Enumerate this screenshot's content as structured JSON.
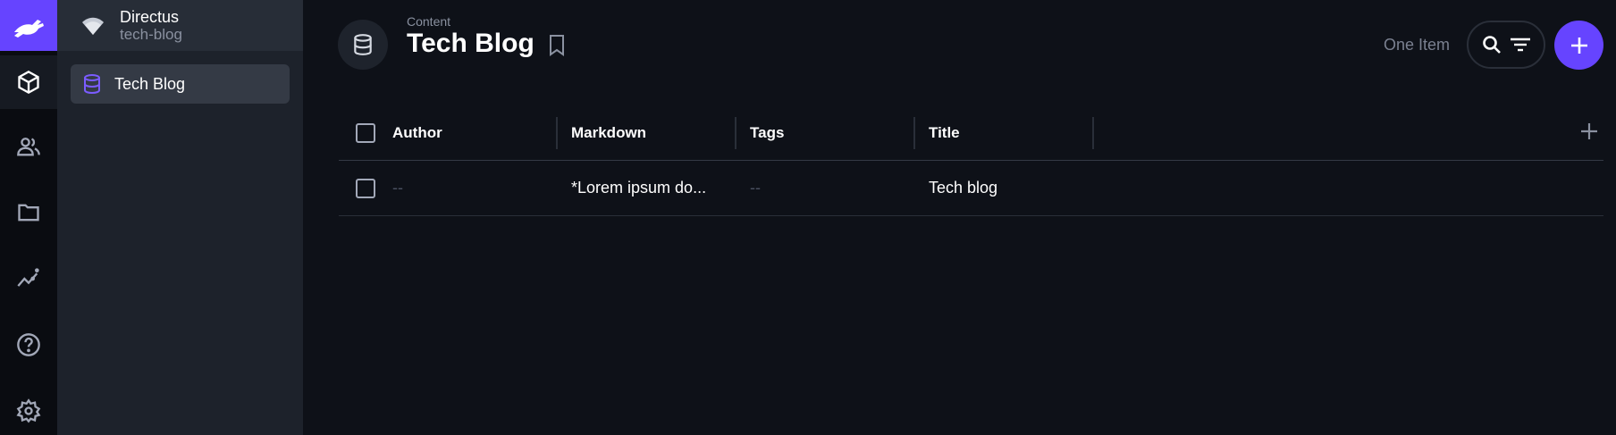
{
  "project": {
    "name": "Directus",
    "subtitle": "tech-blog"
  },
  "navigation": {
    "items": [
      {
        "label": "Tech Blog",
        "icon": "database-icon",
        "active": true
      }
    ]
  },
  "modules": [
    {
      "name": "content",
      "icon": "cube-icon",
      "active": true
    },
    {
      "name": "users",
      "icon": "people-icon"
    },
    {
      "name": "files",
      "icon": "folder-icon"
    },
    {
      "name": "insights",
      "icon": "insights-icon"
    },
    {
      "name": "help",
      "icon": "help-icon"
    },
    {
      "name": "settings",
      "icon": "gear-icon"
    }
  ],
  "header": {
    "breadcrumb": "Content",
    "title": "Tech Blog",
    "item_count": "One Item"
  },
  "table": {
    "columns": [
      "Author",
      "Markdown",
      "Tags",
      "Title"
    ],
    "rows": [
      {
        "author": "--",
        "markdown": "*Lorem ipsum do...",
        "tags": "--",
        "title": "Tech blog"
      }
    ]
  },
  "colors": {
    "accent": "#6644ff",
    "background": "#0e1118",
    "nav_panel": "#1d222b"
  }
}
